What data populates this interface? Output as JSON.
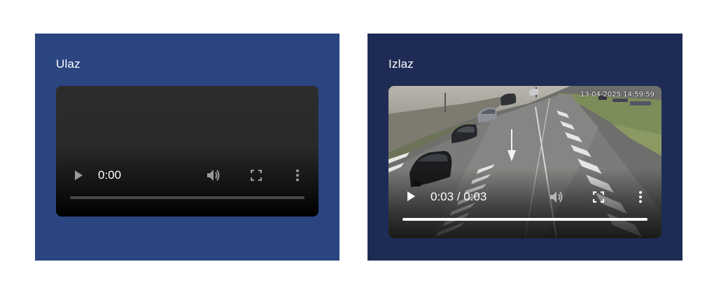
{
  "input_panel": {
    "title": "Ulaz",
    "background": "#2a4580",
    "player": {
      "time": "0:00",
      "progress": 0,
      "icons": [
        "play-icon",
        "volume-icon",
        "fullscreen-icon",
        "more-options-icon"
      ]
    }
  },
  "output_panel": {
    "title": "Izlaz",
    "background": "#1e2c55",
    "player": {
      "time": "0:03 / 0:03",
      "progress": 1.0,
      "overlay_timestamp": "13-04-2025 14:59:59",
      "icons": [
        "play-icon",
        "volume-icon",
        "fullscreen-icon",
        "more-options-icon"
      ]
    }
  }
}
